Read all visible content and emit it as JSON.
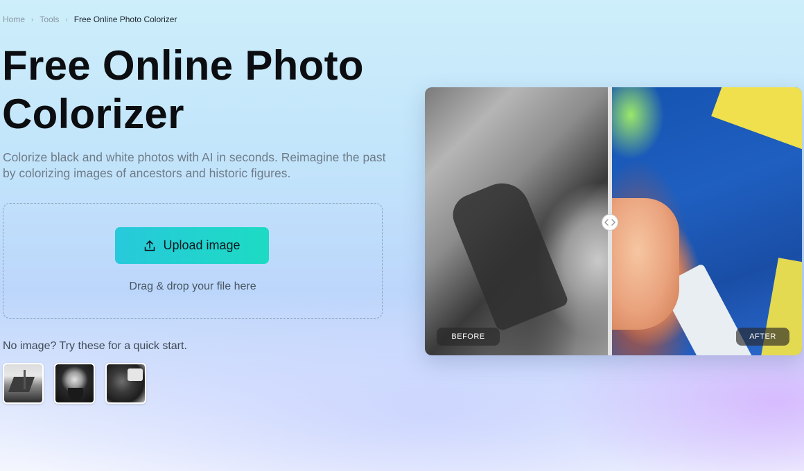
{
  "breadcrumb": {
    "items": [
      {
        "label": "Home"
      },
      {
        "label": "Tools"
      },
      {
        "label": "Free Online Photo Colorizer"
      }
    ]
  },
  "hero": {
    "title": "Free Online Photo Colorizer",
    "subtitle": "Colorize black and white photos with AI in seconds. Reimagine the past by colorizing images of ancestors and historic figures."
  },
  "upload": {
    "button_label": "Upload image",
    "button_icon": "upload-icon",
    "drag_text": "Drag & drop your file here"
  },
  "samples": {
    "label": "No image? Try these for a quick start.",
    "items": [
      {
        "name": "sample-image-1"
      },
      {
        "name": "sample-image-2"
      },
      {
        "name": "sample-image-3"
      }
    ]
  },
  "compare": {
    "before_label": "BEFORE",
    "after_label": "AFTER",
    "handle_icon": "drag-arrows-icon"
  },
  "colors": {
    "button_gradient_start": "#27c9db",
    "button_gradient_end": "#1ddbc3"
  }
}
